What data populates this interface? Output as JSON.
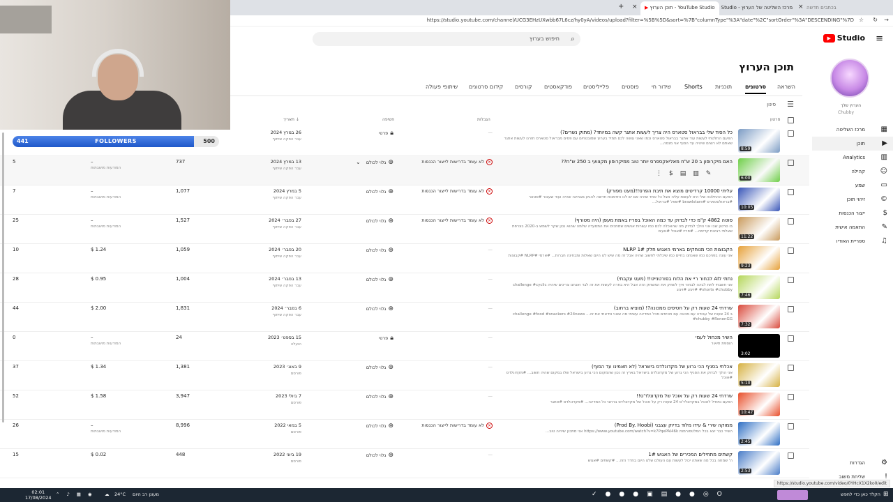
{
  "browser": {
    "tabs": [
      {
        "label": "בכתבים חדשה"
      },
      {
        "label": "מרכז השליטה של הערוץ - Studio"
      },
      {
        "label": "YouTube Studio - תוכן הערוץ"
      }
    ],
    "url": "https://studio.youtube.com/channel/UCG3EHzUXwbb67L6cz/hy0yA/videos/upload?filter=%5B%5D&sort=%7B\"columnType\"%3A\"date\"%2C\"sortOrder\"%3A\"DESCENDING\"%7D"
  },
  "header": {
    "logo_text": "Studio",
    "search_placeholder": "חיפוש בערוץ"
  },
  "sidebar": {
    "channel_title": "הערוץ שלך",
    "channel_name": "Chubby",
    "items": [
      {
        "label": "מרכז השליטה",
        "icon": "dashboard-icon"
      },
      {
        "label": "תוכן",
        "icon": "content-icon",
        "selected": true
      },
      {
        "label": "Analytics",
        "icon": "analytics-icon"
      },
      {
        "label": "קהילה",
        "icon": "community-icon"
      },
      {
        "label": "שמע",
        "icon": "subtitles-icon"
      },
      {
        "label": "זיהוי תוכן",
        "icon": "copyright-icon"
      },
      {
        "label": "ייצור הכנסות",
        "icon": "monetization-icon"
      },
      {
        "label": "התאמה אישית",
        "icon": "customization-icon"
      },
      {
        "label": "ספריית האודיו",
        "icon": "audio-library-icon"
      }
    ],
    "settings_label": "הגדרות",
    "feedback_label": "שליחת משוב"
  },
  "page": {
    "title": "תוכן הערוץ",
    "tabs": [
      "השראה",
      "סרטונים",
      "תוכניות",
      "Shorts",
      "שידור חי",
      "פוסטים",
      "פלייליסטים",
      "פודקאסטים",
      "קורסים",
      "קידום סרטונים",
      "שיתופי פעולה"
    ],
    "active_tab": "סרטונים",
    "filter_label": "סינון",
    "columns": {
      "video": "סרטון",
      "restrictions": "הגבלות",
      "visibility": "חשיפה",
      "date": "תאריך"
    }
  },
  "videos": [
    {
      "title": "כל הסוד שלי בבראול סטארס היה צריך לעשות אתגר קשה במיוחד? (מתוק נשרים?)",
      "desc": "הפעם החלטתי לעשות עוד אתגר בבראול סטארס וכמו שאני עושה לכם תמיד בערוץ שמובטחים עם פסים מבראול סטארס חזרנו לעשות אתגר שאתם לא רוצים שיהיה עד הסוף אני מנסה...",
      "duration": "8:59",
      "visibility": "פרטי",
      "restrictions": "—",
      "date": "26 במרץ 2024",
      "date_sub": "עבר הפקה שיתוף",
      "views": "",
      "revenue": "",
      "monetization": "",
      "comments": "",
      "thumb": "#7c9cc4"
    },
    {
      "title": "האם מיקרופון ב 20 ש\"ח מאליאקספרס יותר טוב ממיקרופון מקצועי ב 250 ש\"ח??",
      "desc": "",
      "duration": "6:00",
      "visibility": "גלוי לכולם",
      "restrictions": "לא עומד בדרישות לייצור הכנסות",
      "date": "13 במרץ 2024",
      "date_sub": "עבר הפקה שיתוף",
      "views": "737",
      "revenue": "–",
      "monetization": "המודעות מושבתות",
      "comments": "5",
      "thumb": "#6fcf49"
    },
    {
      "title": "עליתי 10000 קרדיטים מוצא את תיבת הפרס!!(מעט מפורק)",
      "desc": "הפעם ההחלטה שלי היא לעשות עליה אצל כל אחד שהיה אם יש לנו הזדמנות חדשה להגיע מבחינה שהיה ועוד שעבור #סטאר #בראולסטארס #brawlstars #שאל #בראול...",
      "duration": "10:05",
      "visibility": "גלוי לכולם",
      "restrictions": "לא עומד בדרישות לייצור הכנסות",
      "date": "5 במרץ 2024",
      "date_sub": "עבר הפקה שיתוף",
      "views": "1,077",
      "revenue": "–",
      "monetization": "המודעות מושבתות",
      "comments": "7",
      "thumb": "#3956b8"
    },
    {
      "title": "סוטה 4862 ק\"מ כדי לבדוק עד כמה האוכל בפריז באמת מעפן (היה מטורף)",
      "desc": "בו סרטון שבו אני הולך לבדוק מה שהאכלה לכם כמו עשרות אנשים שמחכים את המסעדה שלמה שהוא נכון שקר לשמש ב-2020 בצרפת שאלתי רצינות קדימה... #פריז #אוכל #טעים",
      "duration": "11:22",
      "visibility": "גלוי לכולם",
      "restrictions": "לא עומד בדרישות לייצור הכנסות",
      "date": "27 בפבר׳ 2024",
      "date_sub": "עבר הפקה שיתוף",
      "views": "1,527",
      "revenue": "–",
      "monetization": "המודעות מושבתות",
      "comments": "25",
      "thumb": "#c99a5c"
    },
    {
      "title": "הקבוצות הכי מנוחקים בארמי האגוש חלק 1# NLRP",
      "desc": "אני עונה בפניכם כמו שאנחנו בחיים כמו שיכלתי לחשוב שהיה אבל זה מה שיש לנו היום שאלות ומבחינה חברות... #ארמי #NLRP #קבוצות",
      "duration": "9:23",
      "visibility": "גלוי לכולם",
      "restrictions": "—",
      "date": "20 בפבר׳ 2024",
      "date_sub": "עבר הפקה שיתוף",
      "views": "1,059",
      "revenue": "$ 1.24",
      "monetization": "",
      "comments": "10",
      "thumb": "#e6a13a"
    },
    {
      "title": "נתתי לAI לבחור ריי את הלוח בפורטנייט!! (מעט עקבתי)",
      "desc": "אני חשבתי לתת לבינה לבחור איך לשחק את המשחק הזה אבל היא בחרה לעשות את זה לבד ואנחנו צריכים שיהיה challenge #cyclic #shorts #chubby #זיגזג #זיגזג",
      "duration": "7:46",
      "visibility": "גלוי לכולם",
      "restrictions": "—",
      "date": "13 בפבר׳ 2024",
      "date_sub": "עבר הפקה שיתוף",
      "views": "1,004",
      "revenue": "$ 0.95",
      "monetization": "",
      "comments": "28",
      "thumb": "#b4d65a"
    },
    {
      "title": "שרדתי 24 שעות רק על חטיפים ממכונה?! (מוציא ברחוב)",
      "desc": "ב 24 שעות של עבודה עם מכונה עם חטיפים מכל המדינה עשיתי מה שאני ווידאתי את זה... challenge #food #snackers #24news #chubby #RonenGG",
      "duration": "7:32",
      "visibility": "גלוי לכולם",
      "restrictions": "—",
      "date": "6 בפבר׳ 2024",
      "date_sub": "עבר הפקה שיתוף",
      "views": "1,831",
      "revenue": "$ 2.00",
      "monetization": "",
      "comments": "44",
      "thumb": "#d94a3c"
    },
    {
      "title": "השיר מכחול לעמי",
      "desc": "הוספת תיאור",
      "duration": "3:02",
      "visibility": "פרטי",
      "restrictions": "—",
      "date": "15 בספט׳ 2023",
      "date_sub": "הועלה",
      "views": "24",
      "revenue": "–",
      "monetization": "המודעות מושבתות",
      "comments": "0",
      "thumb": "#000000"
    },
    {
      "title": "אכלתי בסניף הכי גרוע של מקדונלדס בישראל (לא תאמינו עד הסוף)",
      "desc": "אני הולך לבדוק את הסניף הכי גרוע של מקדונלדס בישראל בארץ זה נכון שהמקום הכי גרוע בישראל שלו במקום שהיה חשוב... #מקדונלדס #אוכל",
      "duration": "5:10",
      "visibility": "גלוי לכולם",
      "restrictions": "—",
      "date": "9 באוג׳ 2023",
      "date_sub": "פורסם",
      "views": "1,381",
      "revenue": "$ 1.34",
      "monetization": "",
      "comments": "37",
      "thumb": "#d6b142"
    },
    {
      "title": "שרדתי 24 שעות רק על אוכל של מקדונלד'ס!!",
      "desc": "הפעם נתחיל לאכול במקדונלד'ס 24 שעות רק על אוכל של מקדונלדס ברחבי כל המדינה... #מקדונלדס #אתגר",
      "duration": "10:47",
      "visibility": "גלוי לכולם",
      "restrictions": "—",
      "date": "7 ביולי 2023",
      "date_sub": "פורסם",
      "views": "3,947",
      "revenue": "$ 1.58",
      "monetization": "",
      "comments": "52",
      "thumb": "#e84f2b"
    },
    {
      "title": "ממוקה שירי & עידו מלוד בדיוק עצבני (Prod By. Hoobi)",
      "desc": "השיר כבר יצא בכל הפלטפורמות https://www.youtube.com/watch?v=k7PqePAI46k אני מתכנן שיהיה טוב...",
      "duration": "2:45",
      "visibility": "גלוי לכולם",
      "restrictions": "לא עומד בדרישות לייצור הכנסות",
      "date": "5 במאי 2022",
      "date_sub": "פורסם",
      "views": "8,996",
      "revenue": "–",
      "monetization": "המודעות מושבתות",
      "comments": "26",
      "thumb": "#2f6fc4"
    },
    {
      "title": "קשתים מתחילים המכירים של האגוש 1#",
      "desc": "ה' שמחה בכל מה שאתה יכול לעשות עם העולם שלנו היום בחדר הזה... #קשתים #אגוש",
      "duration": "2:53",
      "visibility": "גלוי לכולם",
      "restrictions": "—",
      "date": "19 ביוני 2022",
      "date_sub": "פורסם",
      "views": "448",
      "revenue": "$ 0.02",
      "monetization": "",
      "comments": "15",
      "thumb": "#4a7dc8"
    }
  ],
  "overlay": {
    "followers_current": "441",
    "followers_label": "FOLLOWERS",
    "followers_goal": "500",
    "followers_progress": 0.88
  },
  "taskbar": {
    "time": "02:01",
    "date": "17/08/2024",
    "weather": "24°C",
    "weather_text": "מעונן רב היום",
    "search_text": "הקלד כאן כדי לחפש"
  },
  "status_url": "https://studio.youtube.com/video/0YHcX1X2ko0/edit"
}
